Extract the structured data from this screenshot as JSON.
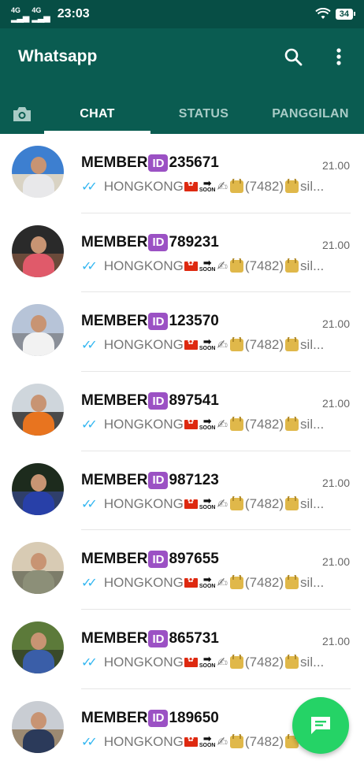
{
  "status_bar": {
    "sim1": "4G",
    "sim2": "4G",
    "time": "23:03",
    "battery": "34"
  },
  "app_bar": {
    "title": "Whatsapp"
  },
  "tabs": [
    {
      "label": "CHAT"
    },
    {
      "label": "STATUS"
    },
    {
      "label": "PANGGILAN"
    }
  ],
  "chats": [
    {
      "name_prefix": "MEMBER",
      "badge": "ID",
      "number": "235671",
      "time": "21.00",
      "preview_text": "HONGKONG",
      "code": "(7482)",
      "suffix": "sil..."
    },
    {
      "name_prefix": "MEMBER",
      "badge": "ID",
      "number": "789231",
      "time": "21.00",
      "preview_text": "HONGKONG",
      "code": "(7482)",
      "suffix": "sil..."
    },
    {
      "name_prefix": "MEMBER",
      "badge": "ID",
      "number": "123570",
      "time": "21.00",
      "preview_text": "HONGKONG",
      "code": "(7482)",
      "suffix": "sil..."
    },
    {
      "name_prefix": "MEMBER",
      "badge": "ID",
      "number": "897541",
      "time": "21.00",
      "preview_text": "HONGKONG",
      "code": "(7482)",
      "suffix": "sil..."
    },
    {
      "name_prefix": "MEMBER",
      "badge": "ID",
      "number": "987123",
      "time": "21.00",
      "preview_text": "HONGKONG",
      "code": "(7482)",
      "suffix": "sil..."
    },
    {
      "name_prefix": "MEMBER",
      "badge": "ID",
      "number": "897655",
      "time": "21.00",
      "preview_text": "HONGKONG",
      "code": "(7482)",
      "suffix": "sil..."
    },
    {
      "name_prefix": "MEMBER",
      "badge": "ID",
      "number": "865731",
      "time": "21.00",
      "preview_text": "HONGKONG",
      "code": "(7482)",
      "suffix": "sil..."
    },
    {
      "name_prefix": "MEMBER",
      "badge": "ID",
      "number": "189650",
      "time": "",
      "preview_text": "HONGKONG",
      "code": "(7482)",
      "suffix": ""
    }
  ],
  "soon_label": "SOON",
  "icons": {
    "search": "search-icon",
    "more": "more-vert-icon",
    "camera": "camera-icon",
    "fab": "new-chat-icon",
    "read": "double-check-icon"
  },
  "colors": {
    "header": "#0a5c51",
    "status_bar": "#074e45",
    "fab": "#25d366",
    "id_badge": "#9b51c4",
    "read_tick": "#34b7f1"
  }
}
